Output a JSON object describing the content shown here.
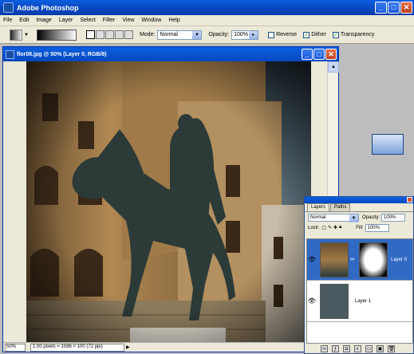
{
  "app": {
    "title": "Adobe Photoshop"
  },
  "menu": [
    "File",
    "Edit",
    "Image",
    "Layer",
    "Select",
    "Filter",
    "View",
    "Window",
    "Help"
  ],
  "options": {
    "mode_label": "Mode:",
    "mode_value": "Normal",
    "opacity_label": "Opacity:",
    "opacity_value": "100%",
    "reverse_label": "Reverse",
    "dither_label": "Dither",
    "transparency_label": "Transparency"
  },
  "document": {
    "title": "flor08.jpg @ 50% (Layer 0, RGB/8)",
    "zoom": "50%",
    "info": "1.00 pixels = 1586 × 100 (72 ppi)"
  },
  "layers_panel": {
    "tabs": [
      "Layers",
      "Paths"
    ],
    "blend_mode": "Normal",
    "opacity_label": "Opacity:",
    "opacity_value": "100%",
    "lock_label": "Lock:",
    "fill_label": "Fill:",
    "fill_value": "100%",
    "layers": [
      {
        "name": "Layer 0",
        "selected": true
      },
      {
        "name": "Layer 1",
        "selected": false
      }
    ]
  },
  "colors": {
    "title_blue": "#0848c0",
    "selection_blue": "#316ac5",
    "layer1_fill": "#4a5a60"
  }
}
